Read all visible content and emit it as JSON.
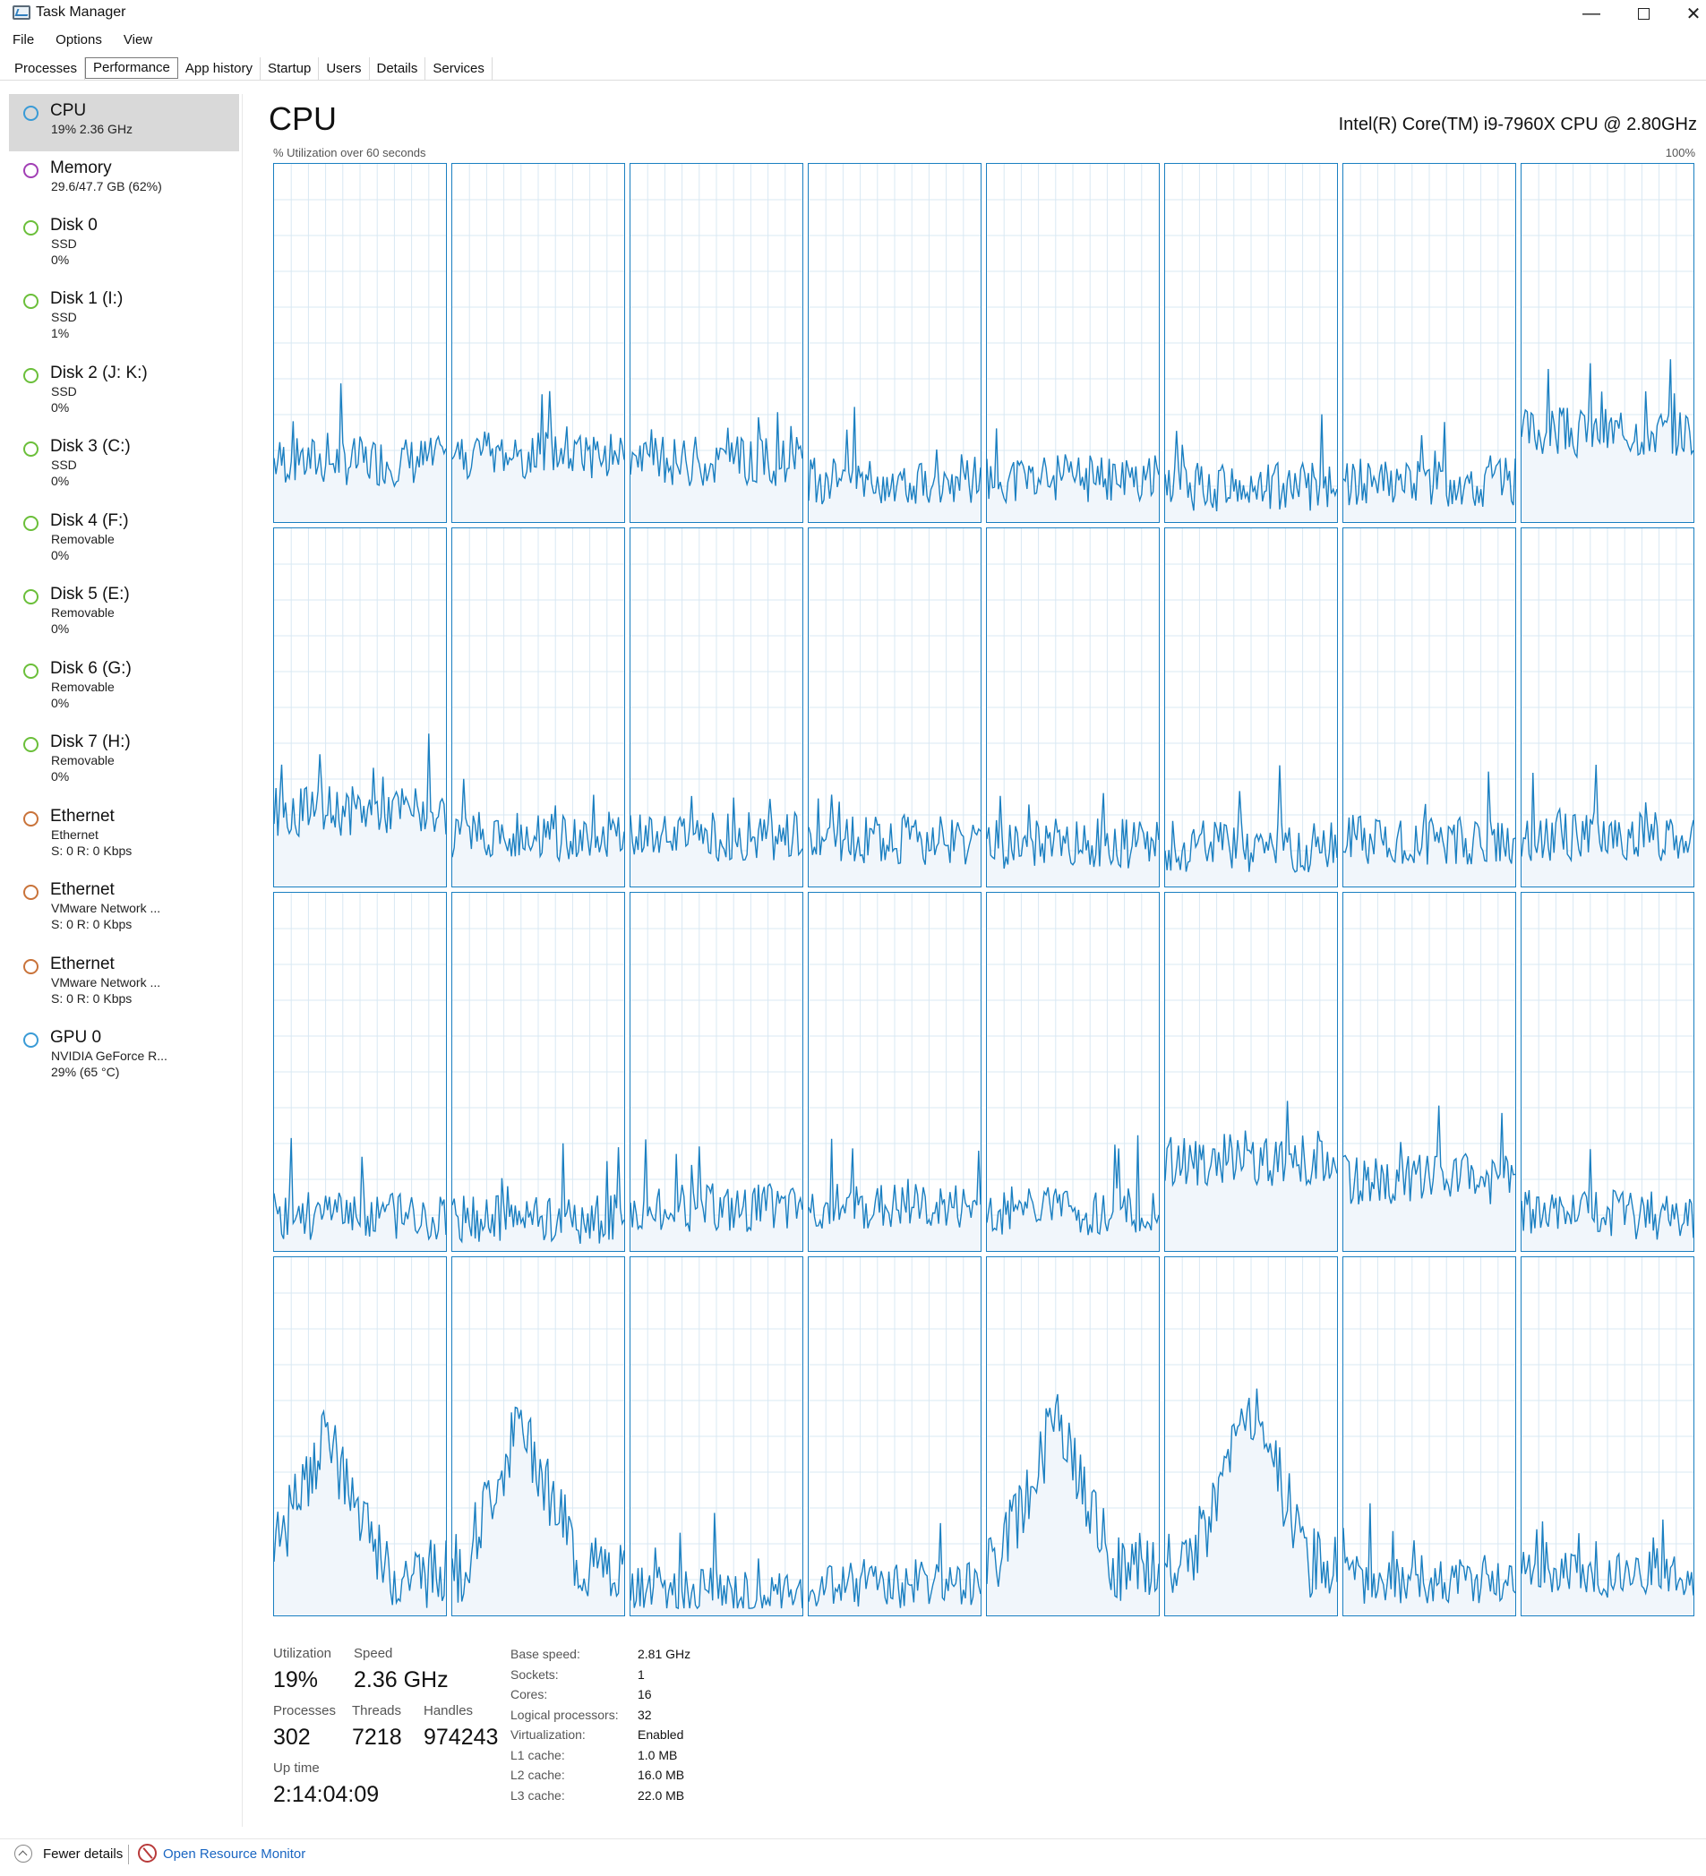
{
  "window": {
    "title": "Task Manager",
    "controls": {
      "minimize": "—",
      "close": "✕"
    }
  },
  "menu": [
    "File",
    "Options",
    "View"
  ],
  "tabs": [
    "Processes",
    "Performance",
    "App history",
    "Startup",
    "Users",
    "Details",
    "Services"
  ],
  "active_tab": "Performance",
  "sidebar": [
    {
      "title": "CPU",
      "lines": [
        "19%  2.36 GHz"
      ],
      "color": "#3a9bd6",
      "selected": true
    },
    {
      "title": "Memory",
      "lines": [
        "29.6/47.7 GB (62%)"
      ],
      "color": "#a23fb5",
      "selected": false
    },
    {
      "title": "Disk 0",
      "lines": [
        "SSD",
        "0%"
      ],
      "color": "#6bbf3a",
      "selected": false
    },
    {
      "title": "Disk 1 (I:)",
      "lines": [
        "SSD",
        "1%"
      ],
      "color": "#6bbf3a",
      "selected": false
    },
    {
      "title": "Disk 2 (J: K:)",
      "lines": [
        "SSD",
        "0%"
      ],
      "color": "#6bbf3a",
      "selected": false
    },
    {
      "title": "Disk 3 (C:)",
      "lines": [
        "SSD",
        "0%"
      ],
      "color": "#6bbf3a",
      "selected": false
    },
    {
      "title": "Disk 4 (F:)",
      "lines": [
        "Removable",
        "0%"
      ],
      "color": "#6bbf3a",
      "selected": false
    },
    {
      "title": "Disk 5 (E:)",
      "lines": [
        "Removable",
        "0%"
      ],
      "color": "#6bbf3a",
      "selected": false
    },
    {
      "title": "Disk 6 (G:)",
      "lines": [
        "Removable",
        "0%"
      ],
      "color": "#6bbf3a",
      "selected": false
    },
    {
      "title": "Disk 7 (H:)",
      "lines": [
        "Removable",
        "0%"
      ],
      "color": "#6bbf3a",
      "selected": false
    },
    {
      "title": "Ethernet",
      "lines": [
        "Ethernet",
        "S: 0 R: 0 Kbps"
      ],
      "color": "#c9733a",
      "selected": false
    },
    {
      "title": "Ethernet",
      "lines": [
        "VMware Network ...",
        "S: 0 R: 0 Kbps"
      ],
      "color": "#c9733a",
      "selected": false
    },
    {
      "title": "Ethernet",
      "lines": [
        "VMware Network ...",
        "S: 0 R: 0 Kbps"
      ],
      "color": "#c9733a",
      "selected": false
    },
    {
      "title": "GPU 0",
      "lines": [
        "NVIDIA GeForce R...",
        "29%  (65 °C)"
      ],
      "color": "#3a9bd6",
      "selected": false
    }
  ],
  "main": {
    "title": "CPU",
    "cpu_model": "Intel(R) Core(TM) i9-7960X CPU @ 2.80GHz",
    "graph_label": "% Utilization over 60 seconds",
    "graph_max": "100%",
    "graph_color": "#1a7fc1",
    "graph_fill": "#f1f6fb",
    "grid_color": "#d8e8f3",
    "logical_processor_levels": [
      0.17,
      0.19,
      0.17,
      0.12,
      0.12,
      0.1,
      0.11,
      0.25,
      0.21,
      0.14,
      0.14,
      0.13,
      0.12,
      0.11,
      0.13,
      0.14,
      0.1,
      0.09,
      0.12,
      0.13,
      0.11,
      0.25,
      0.2,
      0.1,
      0.4,
      0.45,
      0.07,
      0.09,
      0.45,
      0.5,
      0.1,
      0.12
    ]
  },
  "stats": {
    "utilization_label": "Utilization",
    "utilization": "19%",
    "speed_label": "Speed",
    "speed": "2.36 GHz",
    "processes_label": "Processes",
    "processes": "302",
    "threads_label": "Threads",
    "threads": "7218",
    "handles_label": "Handles",
    "handles": "974243",
    "uptime_label": "Up time",
    "uptime": "2:14:04:09"
  },
  "specs": [
    {
      "label": "Base speed:",
      "value": "2.81 GHz"
    },
    {
      "label": "Sockets:",
      "value": "1"
    },
    {
      "label": "Cores:",
      "value": "16"
    },
    {
      "label": "Logical processors:",
      "value": "32"
    },
    {
      "label": "Virtualization:",
      "value": "Enabled"
    },
    {
      "label": "L1 cache:",
      "value": "1.0 MB"
    },
    {
      "label": "L2 cache:",
      "value": "16.0 MB"
    },
    {
      "label": "L3 cache:",
      "value": "22.0 MB"
    }
  ],
  "footer": {
    "fewer_details": "Fewer details",
    "open_resource_monitor": "Open Resource Monitor"
  }
}
